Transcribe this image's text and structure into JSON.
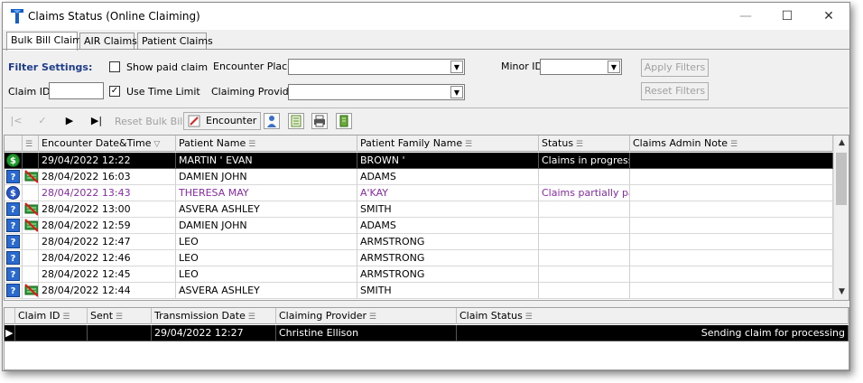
{
  "window": {
    "title": "Claims Status (Online Claiming)"
  },
  "tabs": [
    {
      "label": "Bulk Bill Claims",
      "active": true
    },
    {
      "label": "AIR Claims",
      "active": false
    },
    {
      "label": "Patient Claims",
      "active": false
    }
  ],
  "filter": {
    "heading": "Filter Settings:",
    "show_paid_claim": {
      "label": "Show paid claim",
      "checked": false
    },
    "use_time_limit": {
      "label": "Use Time Limit",
      "checked": true
    },
    "claim_id": {
      "label": "Claim ID",
      "value": ""
    },
    "encounter_place": {
      "label": "Encounter Place",
      "value": ""
    },
    "claiming_provider": {
      "label": "Claiming Provider",
      "value": ""
    },
    "minor_id": {
      "label": "Minor ID",
      "value": ""
    },
    "apply_label": "Apply Filters",
    "reset_label": "Reset Filters"
  },
  "toolbar": {
    "reset_bulk_bill_label": "Reset Bulk Bill",
    "encounter_label": "Encounter"
  },
  "claims_table": {
    "columns": [
      "",
      "",
      "Encounter Date&Time",
      "Patient Name",
      "Patient Family Name",
      "Status",
      "Claims Admin Note"
    ],
    "rows": [
      {
        "icon": "dollar",
        "cancelled": false,
        "date": "29/04/2022 12:22",
        "name": "MARTIN ' EVAN",
        "family": "BROWN '",
        "status": "Claims in progress",
        "note": "",
        "selected": true,
        "purple": false
      },
      {
        "icon": "question",
        "cancelled": true,
        "date": "28/04/2022 16:03",
        "name": "DAMIEN JOHN",
        "family": "ADAMS",
        "status": "",
        "note": "",
        "selected": false,
        "purple": false
      },
      {
        "icon": "s-dollar",
        "cancelled": false,
        "date": "28/04/2022 13:43",
        "name": "THERESA MAY",
        "family": "A'KAY",
        "status": "Claims partially pai...",
        "note": "",
        "selected": false,
        "purple": true
      },
      {
        "icon": "question",
        "cancelled": true,
        "date": "28/04/2022 13:00",
        "name": "ASVERA ASHLEY",
        "family": "SMITH",
        "status": "",
        "note": "",
        "selected": false,
        "purple": false
      },
      {
        "icon": "question",
        "cancelled": true,
        "date": "28/04/2022 12:59",
        "name": "DAMIEN JOHN",
        "family": "ADAMS",
        "status": "",
        "note": "",
        "selected": false,
        "purple": false
      },
      {
        "icon": "question",
        "cancelled": false,
        "date": "28/04/2022 12:47",
        "name": "LEO",
        "family": "ARMSTRONG",
        "status": "",
        "note": "",
        "selected": false,
        "purple": false
      },
      {
        "icon": "question",
        "cancelled": false,
        "date": "28/04/2022 12:46",
        "name": "LEO",
        "family": "ARMSTRONG",
        "status": "",
        "note": "",
        "selected": false,
        "purple": false
      },
      {
        "icon": "question",
        "cancelled": false,
        "date": "28/04/2022 12:45",
        "name": "LEO",
        "family": "ARMSTRONG",
        "status": "",
        "note": "",
        "selected": false,
        "purple": false
      },
      {
        "icon": "question",
        "cancelled": true,
        "date": "28/04/2022 12:44",
        "name": "ASVERA ASHLEY",
        "family": "SMITH",
        "status": "",
        "note": "",
        "selected": false,
        "purple": false
      }
    ]
  },
  "sub_table": {
    "columns": [
      "Claim ID",
      "Sent",
      "Transmission Date",
      "Claiming Provider",
      "Claim Status"
    ],
    "rows": [
      {
        "claim_id": "",
        "sent": "",
        "transmission_date": "29/04/2022 12:27",
        "provider": "Christine Ellison",
        "status": "Sending claim for processing"
      }
    ]
  },
  "colors": {
    "selection": "#000000",
    "partial_status": "#8a2aa8",
    "heading": "#1e3c8c"
  }
}
